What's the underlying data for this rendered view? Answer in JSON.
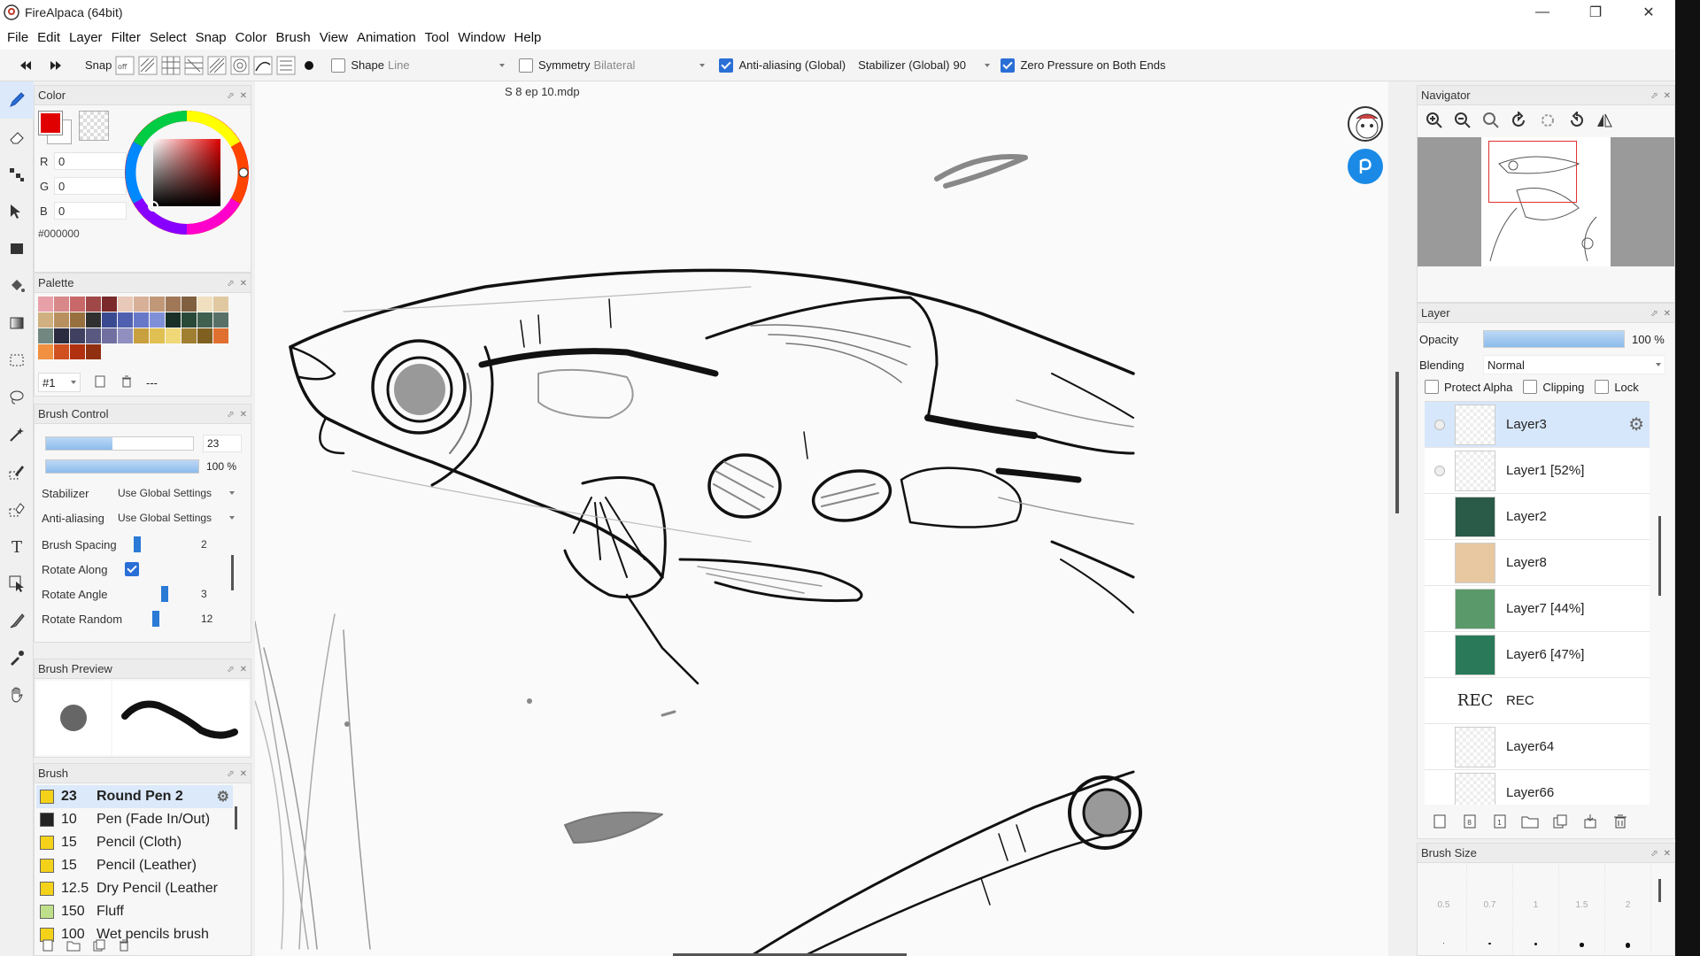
{
  "window": {
    "title": "FireAlpaca (64bit)",
    "controls": [
      "minimize-icon",
      "restore-icon",
      "close-icon"
    ]
  },
  "menu": [
    "File",
    "Edit",
    "Layer",
    "Filter",
    "Select",
    "Snap",
    "Color",
    "Brush",
    "View",
    "Animation",
    "Tool",
    "Window",
    "Help"
  ],
  "toolbar": {
    "snap_label": "Snap",
    "shape_label": "Shape",
    "shape_value": "Line",
    "symmetry_label": "Symmetry",
    "symmetry_value": "Bilateral",
    "antialias_label": "Anti-aliasing (Global)",
    "stabilizer_label": "Stabilizer (Global)",
    "stabilizer_value": "90",
    "zero_pressure_label": "Zero Pressure on Both Ends"
  },
  "color_panel": {
    "title": "Color",
    "r_label": "R",
    "r": "0",
    "g_label": "G",
    "g": "0",
    "b_label": "B",
    "b": "0",
    "hex": "#000000",
    "primary": "#000000"
  },
  "palette_panel": {
    "title": "Palette",
    "swatches": [
      "#e8a0a8",
      "#d88888",
      "#c86868",
      "#a04848",
      "#7a2a2a",
      "#e8c8b8",
      "#d8b098",
      "#c09878",
      "#a07858",
      "#806040",
      "#f0e0c0",
      "#e0c8a0",
      "#d0b080",
      "#b89060",
      "#987040",
      "#303030",
      "#3a4a90",
      "#5060b0",
      "#6878c8",
      "#8090d8",
      "#183028",
      "#284838",
      "#406050",
      "#587068",
      "#708880",
      "#2a2a40",
      "#404060",
      "#585880",
      "#7070a0",
      "#9090c0",
      "#c8a040",
      "#e0c050",
      "#f0d878",
      "#a08030",
      "#806020",
      "#e07030",
      "#f09040",
      "#d05020",
      "#b03010",
      "#903010"
    ],
    "set_label": "#1",
    "more_label": "---"
  },
  "brush_control": {
    "title": "Brush Control",
    "size": "23",
    "size_fraction": 0.45,
    "opacity": "100 %",
    "opacity_fraction": 1.0,
    "stabilizer_label": "Stabilizer",
    "stabilizer_value": "Use Global Settings",
    "antialias_label": "Anti-aliasing",
    "antialias_value": "Use Global Settings",
    "spacing_label": "Brush Spacing",
    "spacing_value": "2",
    "spacing_fraction": 0.05,
    "rotate_along_label": "Rotate Along",
    "rotate_angle_label": "Rotate Angle",
    "rotate_angle_value": "3",
    "rotate_angle_fraction": 0.5,
    "rotate_random_label": "Rotate Random",
    "rotate_random_value": "12",
    "rotate_random_fraction": 0.35
  },
  "brush_preview": {
    "title": "Brush Preview"
  },
  "brush_panel": {
    "title": "Brush",
    "items": [
      {
        "size": "23",
        "name": "Round Pen 2",
        "chip": "#f5d21a",
        "active": true
      },
      {
        "size": "10",
        "name": "Pen (Fade In/Out)",
        "chip": "#222222",
        "active": false
      },
      {
        "size": "15",
        "name": "Pencil (Cloth)",
        "chip": "#f5d21a",
        "active": false
      },
      {
        "size": "15",
        "name": "Pencil (Leather)",
        "chip": "#f5d21a",
        "active": false
      },
      {
        "size": "12.5",
        "name": "Dry Pencil (Leather",
        "chip": "#f5d21a",
        "active": false
      },
      {
        "size": "150",
        "name": "Fluff",
        "chip": "#bfe08a",
        "active": false
      },
      {
        "size": "100",
        "name": "Wet pencils brush",
        "chip": "#f5d21a",
        "active": false
      }
    ]
  },
  "canvas": {
    "filename": "S 8 ep 10.mdp"
  },
  "navigator": {
    "title": "Navigator"
  },
  "layer_panel": {
    "title": "Layer",
    "opacity_label": "Opacity",
    "opacity_value": "100 %",
    "opacity_fraction": 1.0,
    "blending_label": "Blending",
    "blending_value": "Normal",
    "protect_alpha_label": "Protect Alpha",
    "clipping_label": "Clipping",
    "lock_label": "Lock",
    "layers": [
      {
        "name": "Layer3",
        "active": true,
        "thumb": "#ffffff"
      },
      {
        "name": "Layer1 [52%]",
        "active": false,
        "thumb": "#ffffff"
      },
      {
        "name": "Layer2",
        "active": false,
        "thumb": "#2a5a48"
      },
      {
        "name": "Layer8",
        "active": false,
        "thumb": "#e8c8a0"
      },
      {
        "name": "Layer7 [44%]",
        "active": false,
        "thumb": "#5a9a6a"
      },
      {
        "name": "Layer6 [47%]",
        "active": false,
        "thumb": "#2a7a5a"
      },
      {
        "name": "REC",
        "active": false,
        "thumb": "#ffffff"
      },
      {
        "name": "Layer64",
        "active": false,
        "thumb": "#ffffff"
      },
      {
        "name": "Layer66",
        "active": false,
        "thumb": "#ffffff"
      }
    ],
    "rec_thumb_label": "REC"
  },
  "brush_size_panel": {
    "title": "Brush Size",
    "labels": [
      "0.5",
      "0.7",
      "1",
      "1.5",
      "2"
    ]
  }
}
